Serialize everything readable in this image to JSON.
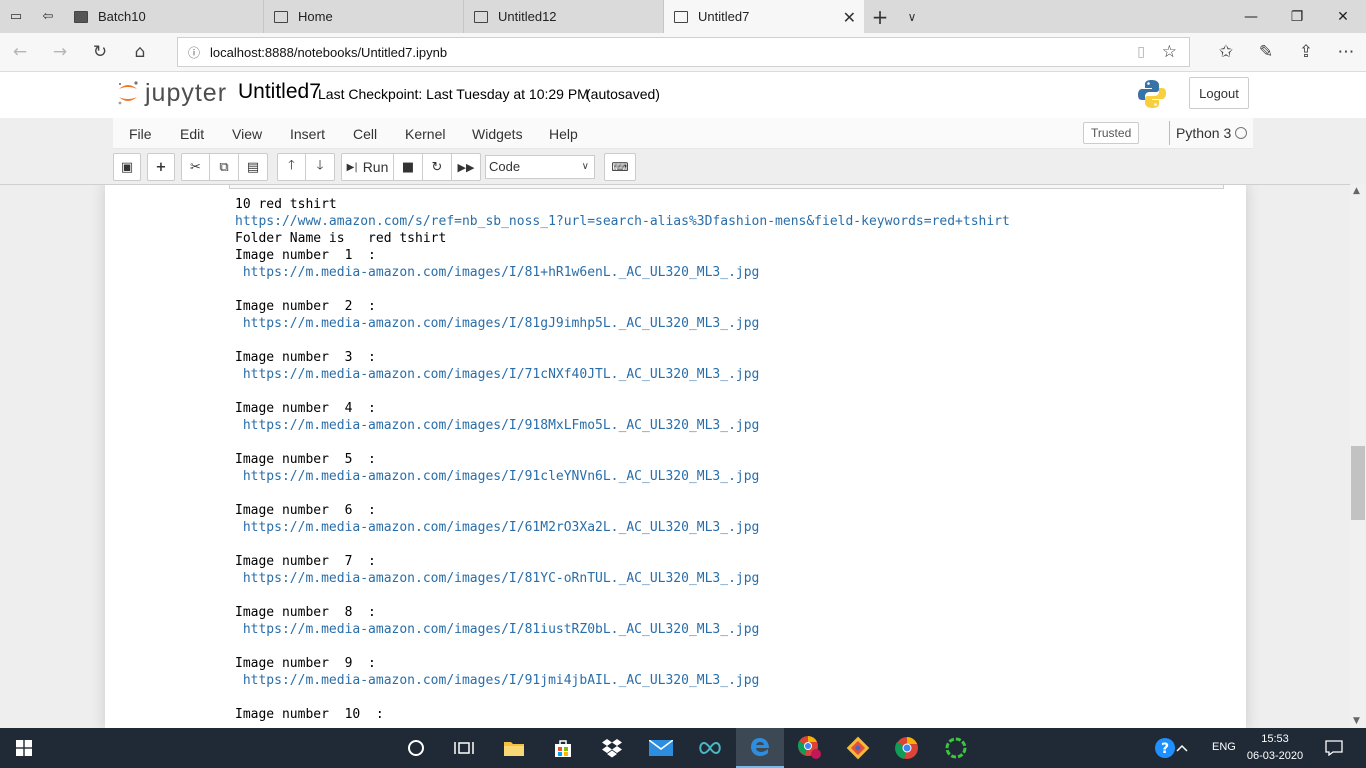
{
  "browser": {
    "tabs": [
      {
        "title": "Batch10",
        "active": false
      },
      {
        "title": "Home",
        "active": false
      },
      {
        "title": "Untitled12",
        "active": false
      },
      {
        "title": "Untitled7",
        "active": true
      }
    ],
    "address": "localhost:8888/notebooks/Untitled7.ipynb"
  },
  "header": {
    "logo_text": "jupyter",
    "notebook_name": "Untitled7",
    "checkpoint": "Last Checkpoint: Last Tuesday at 10:29 PM",
    "autosave": "(autosaved)",
    "logout_label": "Logout"
  },
  "menubar": {
    "items": [
      "File",
      "Edit",
      "View",
      "Insert",
      "Cell",
      "Kernel",
      "Widgets",
      "Help"
    ],
    "trusted_label": "Trusted",
    "kernel_name": "Python 3"
  },
  "toolbar": {
    "run_label": "Run",
    "cell_type": "Code"
  },
  "output": {
    "lines": [
      {
        "text": "10 red tshirt",
        "link": false
      },
      {
        "text": "https://www.amazon.com/s/ref=nb_sb_noss_1?url=search-alias%3Dfashion-mens&field-keywords=red+tshirt",
        "link": true
      },
      {
        "text": "Folder Name is   red tshirt",
        "link": false
      },
      {
        "text": "Image number  1  :",
        "link": false
      },
      {
        "text": " https://m.media-amazon.com/images/I/81+hR1w6enL._AC_UL320_ML3_.jpg",
        "link": true
      },
      {
        "text": "",
        "link": false
      },
      {
        "text": "Image number  2  :",
        "link": false
      },
      {
        "text": " https://m.media-amazon.com/images/I/81gJ9imhp5L._AC_UL320_ML3_.jpg",
        "link": true
      },
      {
        "text": "",
        "link": false
      },
      {
        "text": "Image number  3  :",
        "link": false
      },
      {
        "text": " https://m.media-amazon.com/images/I/71cNXf40JTL._AC_UL320_ML3_.jpg",
        "link": true
      },
      {
        "text": "",
        "link": false
      },
      {
        "text": "Image number  4  :",
        "link": false
      },
      {
        "text": " https://m.media-amazon.com/images/I/918MxLFmo5L._AC_UL320_ML3_.jpg",
        "link": true
      },
      {
        "text": "",
        "link": false
      },
      {
        "text": "Image number  5  :",
        "link": false
      },
      {
        "text": " https://m.media-amazon.com/images/I/91cleYNVn6L._AC_UL320_ML3_.jpg",
        "link": true
      },
      {
        "text": "",
        "link": false
      },
      {
        "text": "Image number  6  :",
        "link": false
      },
      {
        "text": " https://m.media-amazon.com/images/I/61M2rO3Xa2L._AC_UL320_ML3_.jpg",
        "link": true
      },
      {
        "text": "",
        "link": false
      },
      {
        "text": "Image number  7  :",
        "link": false
      },
      {
        "text": " https://m.media-amazon.com/images/I/81YC-oRnTUL._AC_UL320_ML3_.jpg",
        "link": true
      },
      {
        "text": "",
        "link": false
      },
      {
        "text": "Image number  8  :",
        "link": false
      },
      {
        "text": " https://m.media-amazon.com/images/I/81iustRZ0bL._AC_UL320_ML3_.jpg",
        "link": true
      },
      {
        "text": "",
        "link": false
      },
      {
        "text": "Image number  9  :",
        "link": false
      },
      {
        "text": " https://m.media-amazon.com/images/I/91jmi4jbAIL._AC_UL320_ML3_.jpg",
        "link": true
      },
      {
        "text": "",
        "link": false
      },
      {
        "text": "Image number  10  :",
        "link": false
      }
    ]
  },
  "taskbar": {
    "language": "ENG",
    "time": "15:53",
    "date": "06-03-2020"
  },
  "colors": {
    "link": "#296eaa",
    "taskbar": "#1f2a36",
    "jupyter_orange": "#f37726"
  }
}
